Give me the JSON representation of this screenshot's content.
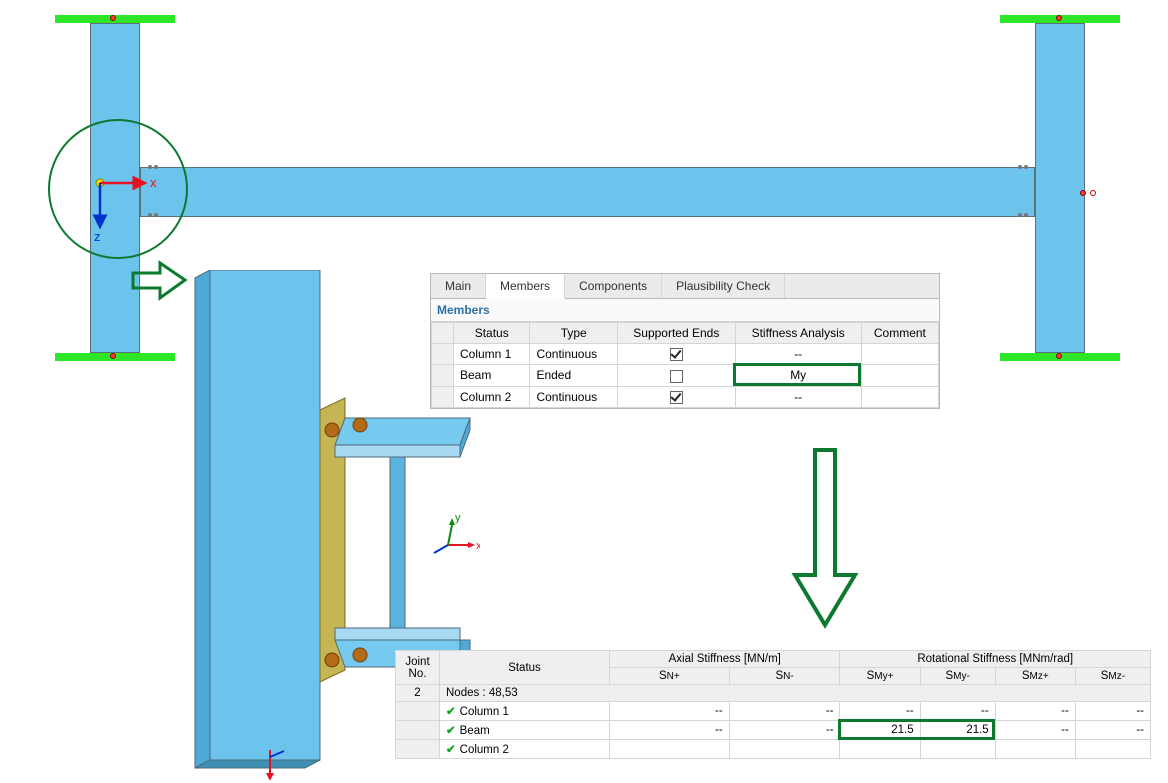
{
  "tabs": [
    "Main",
    "Members",
    "Components",
    "Plausibility Check"
  ],
  "active_tab": "Members",
  "section_title": "Members",
  "table1": {
    "headers": [
      "Status",
      "Type",
      "Supported Ends",
      "Stiffness Analysis",
      "Comment"
    ],
    "rows": [
      {
        "status": "Column 1",
        "type": "Continuous",
        "sup": true,
        "stiff": "--",
        "comment": ""
      },
      {
        "status": "Beam",
        "type": "Ended",
        "sup": false,
        "stiff": "My",
        "comment": ""
      },
      {
        "status": "Column 2",
        "type": "Continuous",
        "sup": true,
        "stiff": "--",
        "comment": ""
      }
    ]
  },
  "table2": {
    "group_header": "Rotational Stiffness [MNm/rad]",
    "group_header2": "Axial Stiffness [MN/m]",
    "joint_label": "Joint No.",
    "joint_no": "2",
    "status_label": "Status",
    "sn_plus": "SN+",
    "sn_minus": "SN-",
    "smy_plus": "SMy+",
    "smy_minus": "SMy-",
    "smz_plus": "SMz+",
    "smz_minus": "SMz-",
    "nodes_row": "Nodes : 48,53",
    "rows": [
      {
        "name": "Column 1",
        "snp": "--",
        "snm": "--",
        "smyp": "--",
        "smym": "--",
        "smzp": "--",
        "smzm": "--"
      },
      {
        "name": "Beam",
        "snp": "--",
        "snm": "--",
        "smyp": "21.5",
        "smym": "21.5",
        "smzp": "--",
        "smzm": "--"
      },
      {
        "name": "Column 2",
        "snp": "",
        "snm": "",
        "smyp": "",
        "smym": "",
        "smzp": "",
        "smzm": ""
      }
    ]
  },
  "axes": {
    "x": "x",
    "z": "z",
    "y": "y"
  }
}
